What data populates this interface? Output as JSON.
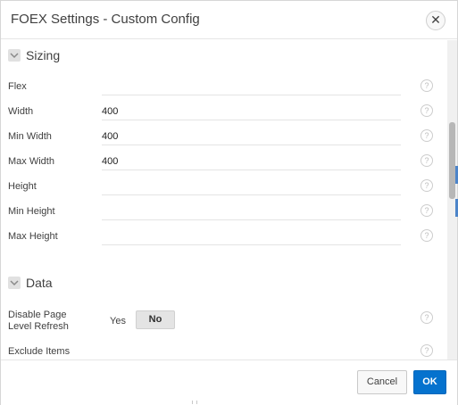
{
  "dialog": {
    "title": "FOEX Settings - Custom Config",
    "close_glyph": "✕"
  },
  "regions": {
    "sizing": {
      "title": "Sizing",
      "rows": [
        {
          "label": "Flex",
          "value": ""
        },
        {
          "label": "Width",
          "value": "400"
        },
        {
          "label": "Min Width",
          "value": "400"
        },
        {
          "label": "Max Width",
          "value": "400"
        },
        {
          "label": "Height",
          "value": ""
        },
        {
          "label": "Min Height",
          "value": ""
        },
        {
          "label": "Max Height",
          "value": ""
        }
      ]
    },
    "data": {
      "title": "Data",
      "disable_refresh": {
        "label": "Disable Page Level Refresh",
        "yes_label": "Yes",
        "no_label": "No",
        "selected": "No"
      },
      "exclude_items": {
        "label": "Exclude Items",
        "value": ""
      }
    }
  },
  "help_glyph": "?",
  "footer": {
    "cancel_label": "Cancel",
    "ok_label": "OK"
  },
  "colors": {
    "primary_button": "#0572ce",
    "toggle_selected": "#e4e4e4",
    "scroll_thumb": "#b7b7b7"
  }
}
